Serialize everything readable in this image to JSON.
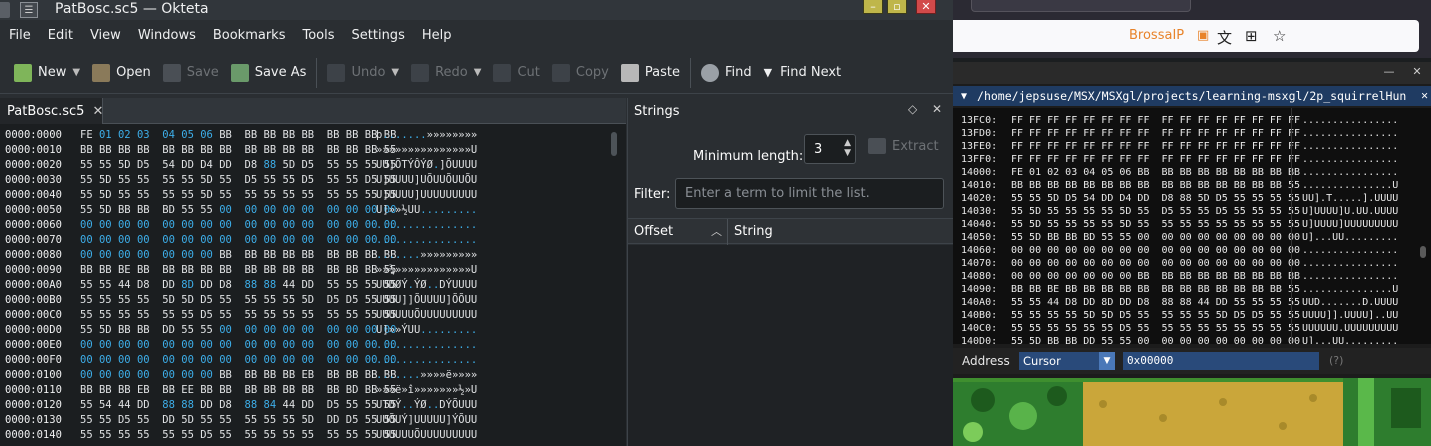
{
  "okteta": {
    "window_title": "PatBosc.sc5 — Okteta",
    "menu": [
      "File",
      "Edit",
      "View",
      "Windows",
      "Bookmarks",
      "Tools",
      "Settings",
      "Help"
    ],
    "toolbar": {
      "new": "New",
      "open": "Open",
      "save": "Save",
      "save_as": "Save As",
      "undo": "Undo",
      "redo": "Redo",
      "cut": "Cut",
      "copy": "Copy",
      "paste": "Paste",
      "find": "Find",
      "find_next": "Find Next"
    },
    "tab_label": "PatBosc.sc5",
    "hex_rows": [
      {
        "offset": "0000:0000",
        "hex": "FE 01 02 03  04 05 06 BB  BB BB BB BB  BB BB BB BB",
        "ascii": "þ.......»»»»»»»»"
      },
      {
        "offset": "0000:0010",
        "hex": "BB BB BB BB  BB BB BB BB  BB BB BB BB  BB BB BB 55",
        "ascii": "»»»»»»»»»»»»»»»U"
      },
      {
        "offset": "0000:0020",
        "hex": "55 55 5D D5  54 DD D4 DD  D8 88 5D D5  55 55 55 55",
        "ascii": "UU]ÕTÝÔÝØ.]ÕUUUU"
      },
      {
        "offset": "0000:0030",
        "hex": "55 5D 55 55  55 55 5D 55  D5 55 55 D5  55 55 D5 55",
        "ascii": "U]UUUU]UÕUUÕUUÕU"
      },
      {
        "offset": "0000:0040",
        "hex": "55 5D 55 55  55 55 5D 55  55 55 55 55  55 55 55 55",
        "ascii": "U]UUUU]UUUUUUUUU"
      },
      {
        "offset": "0000:0050",
        "hex": "55 5D BB BB  BD 55 55 00  00 00 00 00  00 00 00 00",
        "ascii": "U]»»½UU........."
      },
      {
        "offset": "0000:0060",
        "hex": "00 00 00 00  00 00 00 00  00 00 00 00  00 00 00 00",
        "ascii": "................"
      },
      {
        "offset": "0000:0070",
        "hex": "00 00 00 00  00 00 00 00  00 00 00 00  00 00 00 00",
        "ascii": "................"
      },
      {
        "offset": "0000:0080",
        "hex": "00 00 00 00  00 00 00 BB  BB BB BB BB  BB BB BB BB",
        "ascii": ".......»»»»»»»»»"
      },
      {
        "offset": "0000:0090",
        "hex": "BB BB BE BB  BB BB BB BB  BB BB BB BB  BB BB BB 55",
        "ascii": "»»¾»»»»»»»»»»»»U"
      },
      {
        "offset": "0000:00A0",
        "hex": "55 55 44 D8  DD 8D DD D8  88 88 44 DD  55 55 55 55",
        "ascii": "UUDØÝ.ÝØ..DÝUUUU"
      },
      {
        "offset": "0000:00B0",
        "hex": "55 55 55 55  5D 5D D5 55  55 55 55 5D  D5 D5 55 55",
        "ascii": "UUUU]]ÕUUUU]ÕÕUU"
      },
      {
        "offset": "0000:00C0",
        "hex": "55 55 55 55  55 55 D5 55  55 55 55 55  55 55 55 55",
        "ascii": "UUUUUUÕUUUUUUUUU"
      },
      {
        "offset": "0000:00D0",
        "hex": "55 5D BB BB  DD 55 55 00  00 00 00 00  00 00 00 00",
        "ascii": "U]»»ÝUU........."
      },
      {
        "offset": "0000:00E0",
        "hex": "00 00 00 00  00 00 00 00  00 00 00 00  00 00 00 00",
        "ascii": "................"
      },
      {
        "offset": "0000:00F0",
        "hex": "00 00 00 00  00 00 00 00  00 00 00 00  00 00 00 00",
        "ascii": "................"
      },
      {
        "offset": "0000:0100",
        "hex": "00 00 00 00  00 00 00 BB  BB BB BB EB  BB BB BB BB",
        "ascii": ".......»»»»ë»»»»"
      },
      {
        "offset": "0000:0110",
        "hex": "BB BB BB EB  BB EE BB BB  BB BB BB BB  BB BD BB 55",
        "ascii": "»»»ë»î»»»»»»»½»U"
      },
      {
        "offset": "0000:0120",
        "hex": "55 54 44 DD  88 88 DD D8  88 84 44 DD  D5 55 55 55",
        "ascii": "UTDÝ..ÝØ..DÝÕUUU"
      },
      {
        "offset": "0000:0130",
        "hex": "55 55 D5 55  DD 5D 55 55  55 55 55 5D  DD D5 55 55",
        "ascii": "UUÕUÝ]UUUUU]ÝÕUU"
      },
      {
        "offset": "0000:0140",
        "hex": "55 55 55 55  55 55 D5 55  55 55 55 55  55 55 55 55",
        "ascii": "UUUUUUÕUUUUUUUUU"
      }
    ],
    "strings_panel": {
      "title": "Strings",
      "min_length_label": "Minimum length:",
      "min_length_value": "3",
      "extract_label": "Extract",
      "filter_label": "Filter:",
      "filter_placeholder": "Enter a term to limit the list.",
      "col_offset": "Offset",
      "col_string": "String"
    }
  },
  "browser": {
    "site_label": "BrossaIP"
  },
  "emulator": {
    "path": "/home/jepsuse/MSX/MSXgl/projects/learning-msxgl/2p_squirrelHun",
    "mem_rows": [
      {
        "addr": "13FC0:",
        "hex": "FF FF FF FF FF FF FF FF  FF FF FF FF FF FF FF FF",
        "text": "................"
      },
      {
        "addr": "13FD0:",
        "hex": "FF FF FF FF FF FF FF FF  FF FF FF FF FF FF FF FF",
        "text": "................"
      },
      {
        "addr": "13FE0:",
        "hex": "FF FF FF FF FF FF FF FF  FF FF FF FF FF FF FF FF",
        "text": "................"
      },
      {
        "addr": "13FF0:",
        "hex": "FF FF FF FF FF FF FF FF  FF FF FF FF FF FF FF FF",
        "text": "................"
      },
      {
        "addr": "14000:",
        "hex": "FE 01 02 03 04 05 06 BB  BB BB BB BB BB BB BB BB",
        "text": "................"
      },
      {
        "addr": "14010:",
        "hex": "BB BB BB BB BB BB BB BB  BB BB BB BB BB BB BB 55",
        "text": "...............U"
      },
      {
        "addr": "14020:",
        "hex": "55 55 5D D5 54 DD D4 DD  D8 88 5D D5 55 55 55 55",
        "text": "UU].T.....].UUUU"
      },
      {
        "addr": "14030:",
        "hex": "55 5D 55 55 55 55 5D 55  D5 55 55 D5 55 55 55 55",
        "text": "U]UUUU]U.UU.UUUU"
      },
      {
        "addr": "14040:",
        "hex": "55 5D 55 55 55 55 5D 55  55 55 55 55 55 55 55 55",
        "text": "U]UUUU]UUUUUUUUU"
      },
      {
        "addr": "14050:",
        "hex": "55 5D BB BB BD 55 55 00  00 00 00 00 00 00 00 00",
        "text": "U]...UU........."
      },
      {
        "addr": "14060:",
        "hex": "00 00 00 00 00 00 00 00  00 00 00 00 00 00 00 00",
        "text": "................"
      },
      {
        "addr": "14070:",
        "hex": "00 00 00 00 00 00 00 00  00 00 00 00 00 00 00 00",
        "text": "................"
      },
      {
        "addr": "14080:",
        "hex": "00 00 00 00 00 00 00 BB  BB BB BB BB BB BB BB BB",
        "text": "................"
      },
      {
        "addr": "14090:",
        "hex": "BB BB BE BB BB BB BB BB  BB BB BB BB BB BB BB 55",
        "text": "...............U"
      },
      {
        "addr": "140A0:",
        "hex": "55 55 44 D8 DD 8D DD D8  88 88 44 DD 55 55 55 55",
        "text": "UUD.......D.UUUU"
      },
      {
        "addr": "140B0:",
        "hex": "55 55 55 55 5D 5D D5 55  55 55 55 5D D5 D5 55 55",
        "text": "UUUU]].UUUU]..UU"
      },
      {
        "addr": "140C0:",
        "hex": "55 55 55 55 55 55 D5 55  55 55 55 55 55 55 55 55",
        "text": "UUUUUU.UUUUUUUUU"
      },
      {
        "addr": "140D0:",
        "hex": "55 5D BB BB DD 55 55 00  00 00 00 00 00 00 00 00",
        "text": "U]...UU........."
      }
    ],
    "address_label": "Address",
    "address_mode": "Cursor",
    "address_value": "0x00000",
    "help": "(?)"
  },
  "colors": {
    "accent_blue": "#3daee9",
    "path_bar": "#1f3b62",
    "brossa_orange": "#e8832a"
  }
}
